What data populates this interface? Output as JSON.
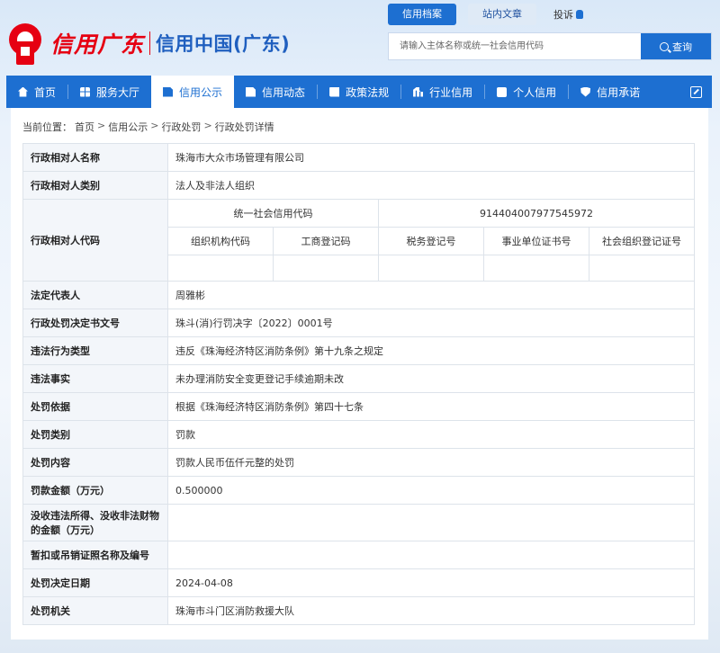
{
  "logo": {
    "script_text": "信用广东",
    "site_name": "信用中国(广东)"
  },
  "top_tabs": [
    {
      "label": "信用档案",
      "active": true
    },
    {
      "label": "站内文章",
      "active": false
    }
  ],
  "report_link": "投诉",
  "search": {
    "placeholder": "请输入主体名称或统一社会信用代码",
    "button_label": "查询"
  },
  "nav": {
    "items": [
      {
        "label": "首页",
        "icon": "home-icon"
      },
      {
        "label": "服务大厅",
        "icon": "grid-icon"
      },
      {
        "label": "信用公示",
        "icon": "announce-icon",
        "active": true
      },
      {
        "label": "信用动态",
        "icon": "news-icon"
      },
      {
        "label": "政策法规",
        "icon": "book-icon"
      },
      {
        "label": "行业信用",
        "icon": "industry-icon"
      },
      {
        "label": "个人信用",
        "icon": "user-icon"
      },
      {
        "label": "信用承诺",
        "icon": "shield-icon"
      }
    ],
    "expand_icon": "expand-icon"
  },
  "breadcrumb": {
    "prefix": "当前位置：",
    "items": [
      "首页",
      "信用公示",
      "行政处罚",
      "行政处罚详情"
    ],
    "separator": ">"
  },
  "detail": {
    "rows": [
      {
        "label": "行政相对人名称",
        "value": "珠海市大众市场管理有限公司"
      },
      {
        "label": "行政相对人类别",
        "value": "法人及非法人组织"
      },
      {
        "label": "法定代表人",
        "value": "周雅彬"
      },
      {
        "label": "行政处罚决定书文号",
        "value": "珠斗(消)行罚决字〔2022〕0001号"
      },
      {
        "label": "违法行为类型",
        "value": "违反《珠海经济特区消防条例》第十九条之规定"
      },
      {
        "label": "违法事实",
        "value": "未办理消防安全变更登记手续逾期未改"
      },
      {
        "label": "处罚依据",
        "value": "根据《珠海经济特区消防条例》第四十七条"
      },
      {
        "label": "处罚类别",
        "value": "罚款"
      },
      {
        "label": "处罚内容",
        "value": "罚款人民币伍仟元整的处罚"
      },
      {
        "label": "罚款金额（万元）",
        "value": "0.500000"
      },
      {
        "label": "没收违法所得、没收非法财物的金额（万元）",
        "value": ""
      },
      {
        "label": "暂扣或吊销证照名称及编号",
        "value": ""
      },
      {
        "label": "处罚决定日期",
        "value": "2024-04-08"
      },
      {
        "label": "处罚机关",
        "value": "珠海市斗门区消防救援大队"
      }
    ],
    "code_block": {
      "label": "行政相对人代码",
      "uscc_label": "统一社会信用代码",
      "uscc_value": "914404007977545972",
      "sub_headers": [
        "组织机构代码",
        "工商登记码",
        "税务登记号",
        "事业单位证书号",
        "社会组织登记证号"
      ],
      "sub_values": [
        "",
        "",
        "",
        "",
        ""
      ]
    }
  }
}
